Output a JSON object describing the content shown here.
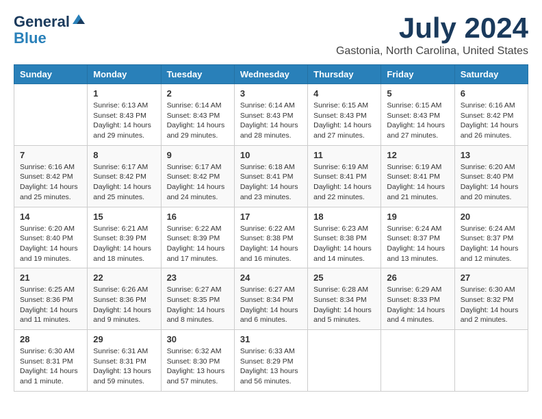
{
  "logo": {
    "line1": "General",
    "line2": "Blue"
  },
  "title": "July 2024",
  "location": "Gastonia, North Carolina, United States",
  "days_of_week": [
    "Sunday",
    "Monday",
    "Tuesday",
    "Wednesday",
    "Thursday",
    "Friday",
    "Saturday"
  ],
  "weeks": [
    [
      {
        "day": "",
        "info": ""
      },
      {
        "day": "1",
        "info": "Sunrise: 6:13 AM\nSunset: 8:43 PM\nDaylight: 14 hours\nand 29 minutes."
      },
      {
        "day": "2",
        "info": "Sunrise: 6:14 AM\nSunset: 8:43 PM\nDaylight: 14 hours\nand 29 minutes."
      },
      {
        "day": "3",
        "info": "Sunrise: 6:14 AM\nSunset: 8:43 PM\nDaylight: 14 hours\nand 28 minutes."
      },
      {
        "day": "4",
        "info": "Sunrise: 6:15 AM\nSunset: 8:43 PM\nDaylight: 14 hours\nand 27 minutes."
      },
      {
        "day": "5",
        "info": "Sunrise: 6:15 AM\nSunset: 8:43 PM\nDaylight: 14 hours\nand 27 minutes."
      },
      {
        "day": "6",
        "info": "Sunrise: 6:16 AM\nSunset: 8:42 PM\nDaylight: 14 hours\nand 26 minutes."
      }
    ],
    [
      {
        "day": "7",
        "info": "Sunrise: 6:16 AM\nSunset: 8:42 PM\nDaylight: 14 hours\nand 25 minutes."
      },
      {
        "day": "8",
        "info": "Sunrise: 6:17 AM\nSunset: 8:42 PM\nDaylight: 14 hours\nand 25 minutes."
      },
      {
        "day": "9",
        "info": "Sunrise: 6:17 AM\nSunset: 8:42 PM\nDaylight: 14 hours\nand 24 minutes."
      },
      {
        "day": "10",
        "info": "Sunrise: 6:18 AM\nSunset: 8:41 PM\nDaylight: 14 hours\nand 23 minutes."
      },
      {
        "day": "11",
        "info": "Sunrise: 6:19 AM\nSunset: 8:41 PM\nDaylight: 14 hours\nand 22 minutes."
      },
      {
        "day": "12",
        "info": "Sunrise: 6:19 AM\nSunset: 8:41 PM\nDaylight: 14 hours\nand 21 minutes."
      },
      {
        "day": "13",
        "info": "Sunrise: 6:20 AM\nSunset: 8:40 PM\nDaylight: 14 hours\nand 20 minutes."
      }
    ],
    [
      {
        "day": "14",
        "info": "Sunrise: 6:20 AM\nSunset: 8:40 PM\nDaylight: 14 hours\nand 19 minutes."
      },
      {
        "day": "15",
        "info": "Sunrise: 6:21 AM\nSunset: 8:39 PM\nDaylight: 14 hours\nand 18 minutes."
      },
      {
        "day": "16",
        "info": "Sunrise: 6:22 AM\nSunset: 8:39 PM\nDaylight: 14 hours\nand 17 minutes."
      },
      {
        "day": "17",
        "info": "Sunrise: 6:22 AM\nSunset: 8:38 PM\nDaylight: 14 hours\nand 16 minutes."
      },
      {
        "day": "18",
        "info": "Sunrise: 6:23 AM\nSunset: 8:38 PM\nDaylight: 14 hours\nand 14 minutes."
      },
      {
        "day": "19",
        "info": "Sunrise: 6:24 AM\nSunset: 8:37 PM\nDaylight: 14 hours\nand 13 minutes."
      },
      {
        "day": "20",
        "info": "Sunrise: 6:24 AM\nSunset: 8:37 PM\nDaylight: 14 hours\nand 12 minutes."
      }
    ],
    [
      {
        "day": "21",
        "info": "Sunrise: 6:25 AM\nSunset: 8:36 PM\nDaylight: 14 hours\nand 11 minutes."
      },
      {
        "day": "22",
        "info": "Sunrise: 6:26 AM\nSunset: 8:36 PM\nDaylight: 14 hours\nand 9 minutes."
      },
      {
        "day": "23",
        "info": "Sunrise: 6:27 AM\nSunset: 8:35 PM\nDaylight: 14 hours\nand 8 minutes."
      },
      {
        "day": "24",
        "info": "Sunrise: 6:27 AM\nSunset: 8:34 PM\nDaylight: 14 hours\nand 6 minutes."
      },
      {
        "day": "25",
        "info": "Sunrise: 6:28 AM\nSunset: 8:34 PM\nDaylight: 14 hours\nand 5 minutes."
      },
      {
        "day": "26",
        "info": "Sunrise: 6:29 AM\nSunset: 8:33 PM\nDaylight: 14 hours\nand 4 minutes."
      },
      {
        "day": "27",
        "info": "Sunrise: 6:30 AM\nSunset: 8:32 PM\nDaylight: 14 hours\nand 2 minutes."
      }
    ],
    [
      {
        "day": "28",
        "info": "Sunrise: 6:30 AM\nSunset: 8:31 PM\nDaylight: 14 hours\nand 1 minute."
      },
      {
        "day": "29",
        "info": "Sunrise: 6:31 AM\nSunset: 8:31 PM\nDaylight: 13 hours\nand 59 minutes."
      },
      {
        "day": "30",
        "info": "Sunrise: 6:32 AM\nSunset: 8:30 PM\nDaylight: 13 hours\nand 57 minutes."
      },
      {
        "day": "31",
        "info": "Sunrise: 6:33 AM\nSunset: 8:29 PM\nDaylight: 13 hours\nand 56 minutes."
      },
      {
        "day": "",
        "info": ""
      },
      {
        "day": "",
        "info": ""
      },
      {
        "day": "",
        "info": ""
      }
    ]
  ]
}
